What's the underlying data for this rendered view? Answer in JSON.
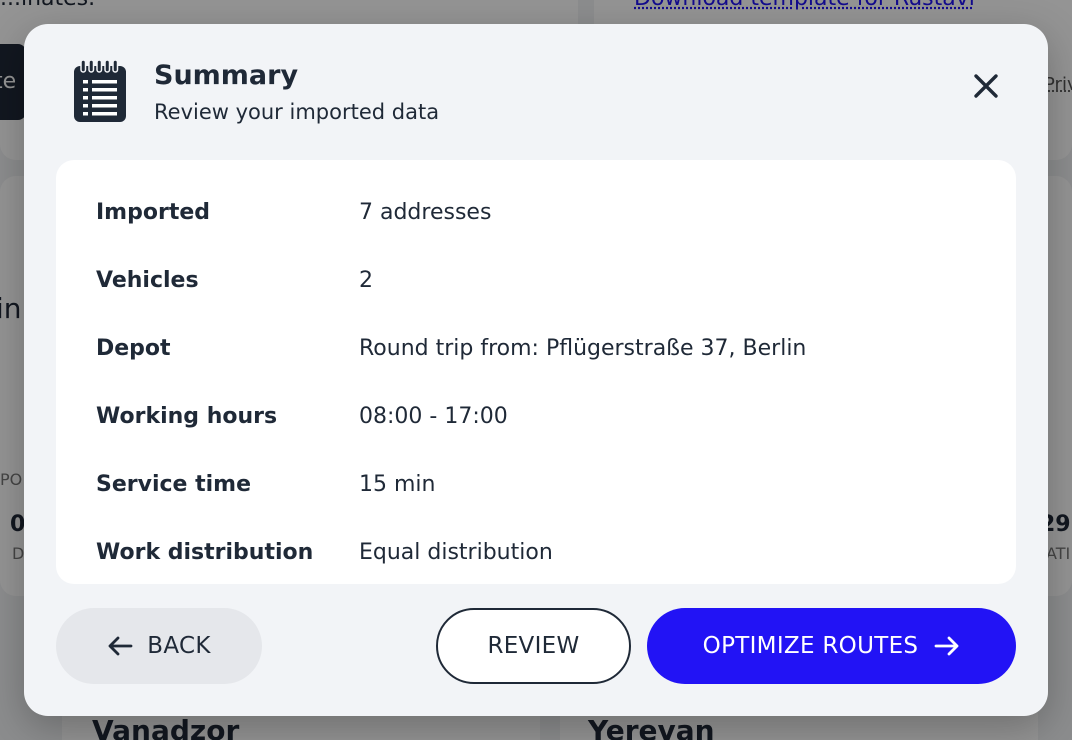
{
  "background": {
    "top_left_fragment": "...inates.",
    "top_right_link": "Download template for Rustavi",
    "right_fragment": "Priva",
    "left_button_fragment": "te",
    "left_heading_fragment": "in",
    "left_label_fragment": "PO",
    "left_value_fragment": "0",
    "left_sub_fragment": "D",
    "right_value_fragment": "29",
    "right_sub_fragment": "ATI",
    "city_left": "Vanadzor",
    "city_right": "Yerevan"
  },
  "modal": {
    "icon": "notepad-list-icon",
    "title": "Summary",
    "subtitle": "Review your imported data",
    "close_icon": "close-icon",
    "rows": [
      {
        "label": "Imported",
        "value": "7 addresses"
      },
      {
        "label": "Vehicles",
        "value": "2"
      },
      {
        "label": "Depot",
        "value": "Round trip from: Pflügerstraße 37, Berlin"
      },
      {
        "label": "Working hours",
        "value": "08:00 - 17:00"
      },
      {
        "label": "Service time",
        "value": "15 min"
      },
      {
        "label": "Work distribution",
        "value": "Equal distribution"
      }
    ],
    "buttons": {
      "back": "BACK",
      "review": "REVIEW",
      "optimize": "OPTIMIZE ROUTES"
    }
  },
  "colors": {
    "primary": "#2213f5",
    "text": "#1f2937",
    "modal_bg": "#f2f4f7",
    "panel_bg": "#ffffff",
    "secondary_button": "#e5e7eb"
  }
}
